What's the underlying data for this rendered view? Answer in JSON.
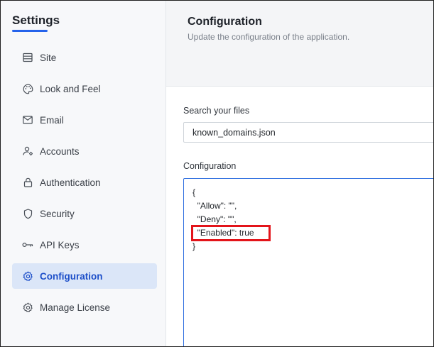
{
  "sidebar": {
    "title": "Settings",
    "items": [
      {
        "label": "Site",
        "icon": "site-icon",
        "active": false
      },
      {
        "label": "Look and Feel",
        "icon": "palette-icon",
        "active": false
      },
      {
        "label": "Email",
        "icon": "mail-icon",
        "active": false
      },
      {
        "label": "Accounts",
        "icon": "accounts-icon",
        "active": false
      },
      {
        "label": "Authentication",
        "icon": "lock-icon",
        "active": false
      },
      {
        "label": "Security",
        "icon": "shield-icon",
        "active": false
      },
      {
        "label": "API Keys",
        "icon": "key-icon",
        "active": false
      },
      {
        "label": "Configuration",
        "icon": "gear-icon",
        "active": true
      },
      {
        "label": "Manage License",
        "icon": "license-gear-icon",
        "active": false
      }
    ]
  },
  "header": {
    "title": "Configuration",
    "subtitle": "Update the configuration of the application."
  },
  "files": {
    "label": "Search your files",
    "value": "known_domains.json"
  },
  "configuration": {
    "label": "Configuration",
    "lines": [
      "{",
      "  \"Allow\": \"\",",
      "  \"Deny\": \"\",",
      "  \"Enabled\": true",
      "}"
    ]
  },
  "colors": {
    "accent": "#2563eb",
    "active_bg": "#dbe6f8",
    "highlight_border": "#e3141a"
  }
}
